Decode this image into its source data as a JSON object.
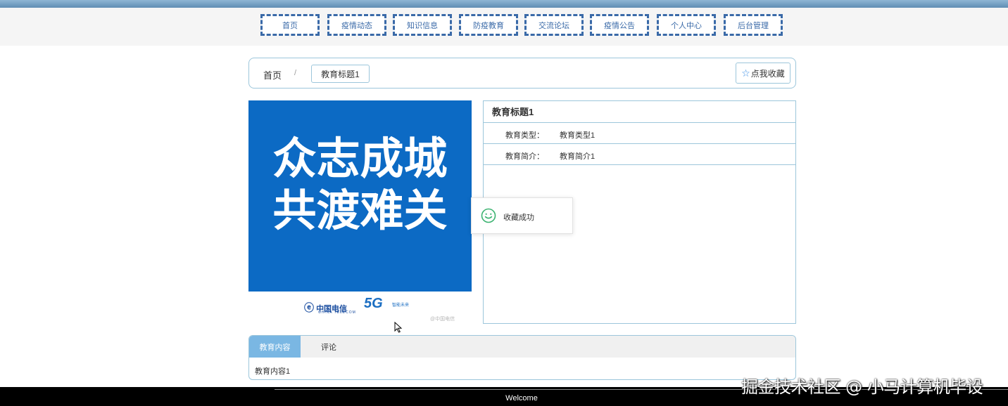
{
  "nav": {
    "items": [
      {
        "label": "首页"
      },
      {
        "label": "疫情动态"
      },
      {
        "label": "知识信息"
      },
      {
        "label": "防疫教育"
      },
      {
        "label": "交流论坛"
      },
      {
        "label": "疫情公告"
      },
      {
        "label": "个人中心"
      },
      {
        "label": "后台管理"
      }
    ]
  },
  "breadcrumb": {
    "home": "首页",
    "separator": "/",
    "current": "教育标题1"
  },
  "favorite_button": {
    "icon": "star-icon",
    "label": "点我收藏"
  },
  "poster": {
    "line1": "众志成城",
    "line2": "共渡难关",
    "brand": "中国电信",
    "brand_sub": "CHINA TELECOM",
    "network": "5G",
    "slogan": "智能未来",
    "credit": "@中国电信"
  },
  "detail": {
    "title": "教育标题1",
    "rows": [
      {
        "label": "教育类型：",
        "value": "教育类型1"
      },
      {
        "label": "教育简介：",
        "value": "教育简介1"
      }
    ]
  },
  "toast": {
    "icon": "smile-icon",
    "message": "收藏成功",
    "color": "#3cb371"
  },
  "tabs": {
    "items": [
      {
        "label": "教育内容",
        "active": true
      },
      {
        "label": "评论",
        "active": false
      }
    ],
    "content": "教育内容1"
  },
  "footer": {
    "text": "Welcome"
  },
  "overlay_watermark": "掘金技术社区 @ 小马计算机毕设",
  "colors": {
    "accent": "#3a6aa8",
    "border": "#9cc6db",
    "poster_blue": "#0c6ac4",
    "tab_active": "#7ab7e3"
  }
}
